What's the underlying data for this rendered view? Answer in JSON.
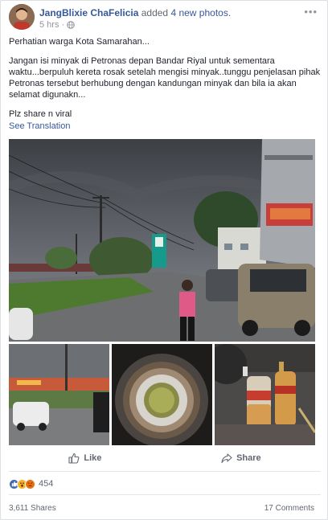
{
  "post": {
    "author_name": "JangBlixie ChaFelicia",
    "action_text": "added",
    "photo_count_text": "4 new photos.",
    "time": "5 hrs",
    "meta_separator": "·",
    "more_icon": "more-horizontal-icon",
    "privacy_icon": "globe-icon",
    "paragraphs": [
      "Perhatian warga Kota Samarahan...",
      "Jangan isi minyak di Petronas depan Bandar Riyal untuk sementara waktu...berpuluh kereta rosak setelah mengisi minyak..tunggu penjelasan pihak Petronas tersebut berhubung dengan kandungan minyak dan bila ia akan selamat digunakn...",
      "Plz share n viral"
    ],
    "see_translation": "See Translation"
  },
  "actions": {
    "like_label": "Like",
    "share_label": "Share"
  },
  "footer": {
    "reaction_icons": [
      "like-reaction-icon",
      "wow-reaction-icon",
      "angry-reaction-icon"
    ],
    "reaction_count": "454",
    "shares": "3,611 Shares",
    "comments": "17 Comments"
  },
  "colors": {
    "link_blue": "#365899",
    "meta_gray": "#90949c",
    "like_blue": "#4267b2"
  }
}
